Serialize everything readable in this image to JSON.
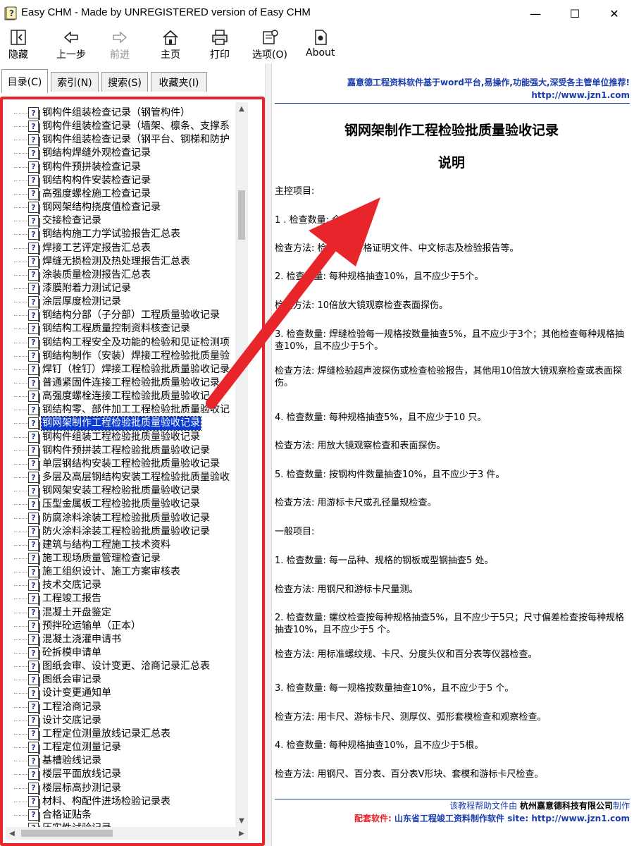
{
  "window": {
    "title": "Easy CHM - Made by UNREGISTERED version of Easy CHM",
    "minimize": "—",
    "maximize": "☐",
    "close": "✕"
  },
  "toolbar": {
    "hide": "隐藏",
    "back": "上一步",
    "forward": "前进",
    "home": "主页",
    "print": "打印",
    "options": "选项(O)",
    "about": "About"
  },
  "tabs": {
    "contents": "目录(C)",
    "index": "索引(N)",
    "search": "搜索(S)",
    "favorites": "收藏夹(I)"
  },
  "tree": {
    "items": [
      "钢构件组装检查记录（钢管构件）",
      "钢构件组装检查记录（墙架、檩条、支撑系",
      "钢构件组装检查记录（钢平台、钢梯和防护",
      "钢结构焊缝外观检查记录",
      "钢构件预拼装检查记录",
      "钢结构构件安装检查记录",
      "高强度螺栓施工检查记录",
      "钢网架结构挠度值检查记录",
      "交接检查记录",
      "钢结构施工力学试验报告汇总表",
      "焊接工艺评定报告汇总表",
      "焊缝无损检测及热处理报告汇总表",
      "涂装质量检测报告汇总表",
      "漆膜附着力测试记录",
      "涂层厚度检测记录",
      "钢结构分部（子分部）工程质量验收记录",
      "钢结构工程质量控制资料核查记录",
      "钢结构工程安全及功能的检验和见证检测项",
      "钢结构制作（安装）焊接工程检验批质量验",
      "焊钉（栓钉）焊接工程检验批质量验收记录",
      "普通紧固件连接工程检验批质量验收记录",
      "高强度螺栓连接工程检验批质量验收记",
      "钢结构零、部件加工工程检验批质量验收记",
      "钢网架制作工程检验批质量验收记录",
      "钢构件组装工程检验批质量验收记录",
      "钢构件预拼装工程检验批质量验收记录",
      "单层钢结构安装工程检验批质量验收记录",
      "多层及高层钢结构安装工程检验批质量验收",
      "钢网架安装工程检验批质量验收记录",
      "压型金属板工程检验批质量验收记录",
      "防腐涂料涂装工程检验批质量验收记录",
      "防火涂料涂装工程检验批质量验收记录",
      "建筑与结构工程施工技术资料",
      "施工现场质量管理检查记录",
      "施工组织设计、施工方案审核表",
      "技术交底记录",
      "工程竣工报告",
      "混凝土开盘鉴定",
      "预拌砼运输单（正本）",
      "混凝土浇灌申请书",
      "砼拆模申请单",
      "图纸会审、设计变更、洽商记录汇总表",
      "图纸会审记录",
      "设计变更通知单",
      "工程洽商记录",
      "设计交底记录",
      "工程定位测量放线记录汇总表",
      "工程定位测量记录",
      "基槽验线记录",
      "楼层平面放线记录",
      "楼层标高抄测记录",
      "材料、构配件进场检验记录表",
      "合格证贴条",
      "压实性试验记录"
    ],
    "selected_index": 23
  },
  "content": {
    "header_slogan": "嘉意德工程资料软件基于word平台,易操作,功能强大,深受各主管单位推荐!",
    "header_url": "http://www.jzn1.com",
    "title": "钢网架制作工程检验批质量验收记录",
    "subtitle": "说明",
    "paragraphs": [
      "主控项目:",
      "1 . 检查数量: 全数检查。",
      "检查方法: 检查质量合格证明文件、中文标志及检验报告等。",
      "2. 检查数量: 每种规格抽查10%，且不应少于5个。",
      "检查方法: 10倍放大镜观察检查表面探伤。",
      "3. 检查数量: 焊缝检验每一规格按数量抽查5%，且不应少于3个；其他检查每种规格抽查10%，且不应少于5个。",
      "检查方法: 焊缝检验超声波探伤或检查检验报告，其他用10倍放大镜观察检查或表面探伤。",
      "4. 检查数量: 每种规格抽查5%，且不应少于10 只。",
      "检查方法: 用放大镜观察检查和表面探伤。",
      "5. 检查数量: 按钢构件数量抽查10%，且不应少于3 件。",
      "检查方法: 用游标卡尺或孔径量规检查。",
      "一般项目:",
      "1. 检查数量: 每一品种、规格的钢板或型钢抽查5 处。",
      "检查方法: 用钢尺和游标卡尺量测。",
      "2. 检查数量: 螺纹检查按每种规格抽查5%，且不应少于5只；尺寸偏差检查按每种规格抽查10%，且不应少于5 个。",
      "检查方法: 用标准螺纹规、卡尺、分度头仪和百分表等仪器检查。",
      "3. 检查数量: 每一规格按数量抽查10%，且不应少于5 个。",
      "检查方法: 用卡尺、游标卡尺、测厚仪、弧形套模检查和观察检查。",
      "4. 检查数量: 每种规格抽查10%，且不应少于5根。",
      "检查方法: 用钢尺、百分表、百分表V形块、套模和游标卡尺检查。"
    ],
    "footer_line1_prefix": "该教程帮助文件由",
    "footer_company": "杭州嘉意德科技有限公司",
    "footer_line1_suffix": "制作",
    "footer_line2_red": "配套软件:",
    "footer_line2_blue": "山东省工程竣工资料制作软件",
    "footer_line2_site": "site: http://www.jzn1.com"
  },
  "colors": {
    "annotation_red": "#e8252a",
    "link_blue": "#1a3cae",
    "selection_blue": "#0a3bd4"
  }
}
